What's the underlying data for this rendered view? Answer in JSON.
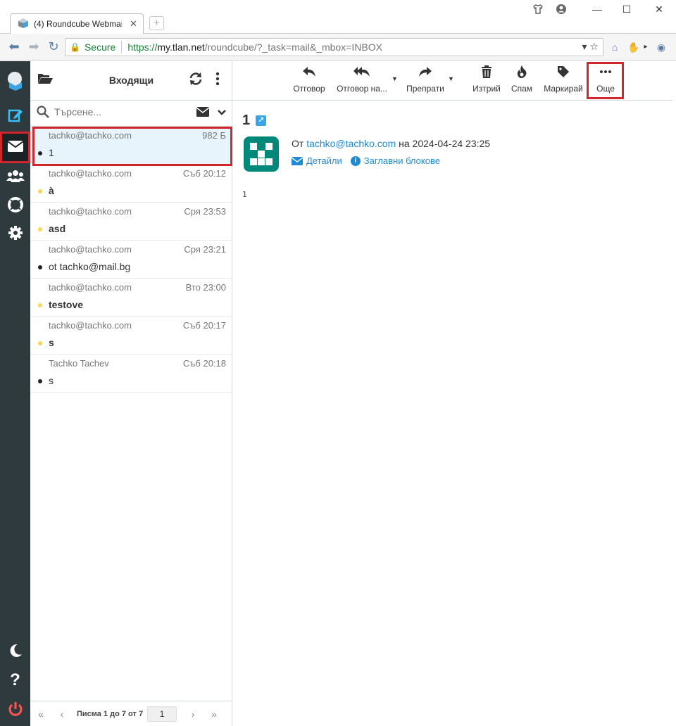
{
  "browser": {
    "tab_title": "(4) Roundcube Webmail ::",
    "secure_label": "Secure",
    "url_proto": "https://",
    "url_host": "my.tlan.net",
    "url_rest": "/roundcube/?_task=mail&_mbox=INBOX"
  },
  "list": {
    "folder_title": "Входящи",
    "search_placeholder": "Търсене...",
    "messages": [
      {
        "from": "tachko@tachko.com",
        "date": "982 Б",
        "subject": "1",
        "flag": false,
        "unread": false
      },
      {
        "from": "tachko@tachko.com",
        "date": "Съб 20:12",
        "subject": "à",
        "flag": true,
        "unread": true
      },
      {
        "from": "tachko@tachko.com",
        "date": "Сря 23:53",
        "subject": "asd",
        "flag": true,
        "unread": true
      },
      {
        "from": "tachko@tachko.com",
        "date": "Сря 23:21",
        "subject": "ot tachko@mail.bg",
        "flag": false,
        "unread": false
      },
      {
        "from": "tachko@tachko.com",
        "date": "Вто 23:00",
        "subject": "testove",
        "flag": true,
        "unread": true
      },
      {
        "from": "tachko@tachko.com",
        "date": "Съб 20:17",
        "subject": "s",
        "flag": true,
        "unread": true
      },
      {
        "from": "Tachko Tachev",
        "date": "Съб 20:18",
        "subject": "s",
        "flag": false,
        "unread": false
      }
    ],
    "pager_text": "Писма 1 до 7 от 7",
    "page": "1"
  },
  "toolbar": {
    "reply": "Отговор",
    "reply_all": "Отговор на...",
    "forward": "Препрати",
    "delete": "Изтрий",
    "spam": "Спам",
    "mark": "Маркирай",
    "more": "Още"
  },
  "message": {
    "subject": "1",
    "from_prefix": "От",
    "from_email": "tachko@tachko.com",
    "date_text": "на 2024-04-24 23:25",
    "details_link": "Детайли",
    "headers_link": "Заглавни блокове",
    "body": "1"
  },
  "colors": {
    "rail_bg": "#2f3a3f",
    "accent": "#37beff",
    "link": "#1e8ad3",
    "highlight_box": "#d0262c",
    "avatar": "#00897b"
  }
}
